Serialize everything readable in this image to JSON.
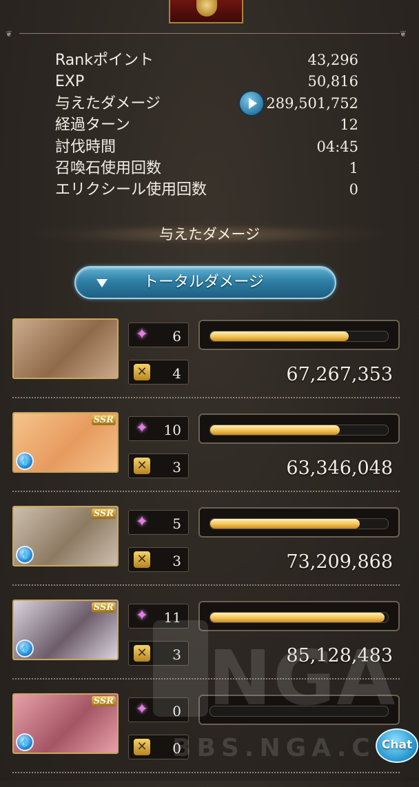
{
  "stats": [
    {
      "label": "Rankポイント",
      "value": "43,296"
    },
    {
      "label": "EXP",
      "value": "50,816"
    },
    {
      "label": "与えたダメージ",
      "value": "289,501,752"
    },
    {
      "label": "経過ターン",
      "value": "12"
    },
    {
      "label": "討伐時間",
      "value": "04:45"
    },
    {
      "label": "召喚石使用回数",
      "value": "1"
    },
    {
      "label": "エリクシール使用回数",
      "value": "0"
    }
  ],
  "section_title": "与えたダメージ",
  "dropdown": {
    "label": "トータルダメージ"
  },
  "characters": [
    {
      "rarity": "",
      "element": "",
      "ca_count": "6",
      "skill_count": "4",
      "damage": "67,267,353",
      "bar_fraction": 0.78,
      "portrait_colors": [
        "#caa98a",
        "#8f6a4a"
      ]
    },
    {
      "rarity": "SSR",
      "element": "water-icon",
      "ca_count": "10",
      "skill_count": "3",
      "damage": "63,346,048",
      "bar_fraction": 0.73,
      "portrait_colors": [
        "#f4c48c",
        "#e79a5e"
      ]
    },
    {
      "rarity": "SSR",
      "element": "water-icon",
      "ca_count": "5",
      "skill_count": "3",
      "damage": "73,209,868",
      "bar_fraction": 0.84,
      "portrait_colors": [
        "#cdbfae",
        "#8c7a62"
      ]
    },
    {
      "rarity": "SSR",
      "element": "water-icon",
      "ca_count": "11",
      "skill_count": "3",
      "damage": "85,128,483",
      "bar_fraction": 0.98,
      "portrait_colors": [
        "#d9d3de",
        "#6d5c6a"
      ]
    },
    {
      "rarity": "SSR",
      "element": "water-icon",
      "ca_count": "0",
      "skill_count": "0",
      "damage": "",
      "bar_fraction": 0.0,
      "portrait_colors": [
        "#e7a0a8",
        "#a45564"
      ]
    }
  ],
  "watermark": {
    "big": "NGA",
    "small": "BBS.NGA.C"
  },
  "chat_button": {
    "label": "Chat"
  },
  "colors": {
    "accent": "#2f7fa6",
    "bar_fill": "#f2c256",
    "background": "#2d2823"
  }
}
